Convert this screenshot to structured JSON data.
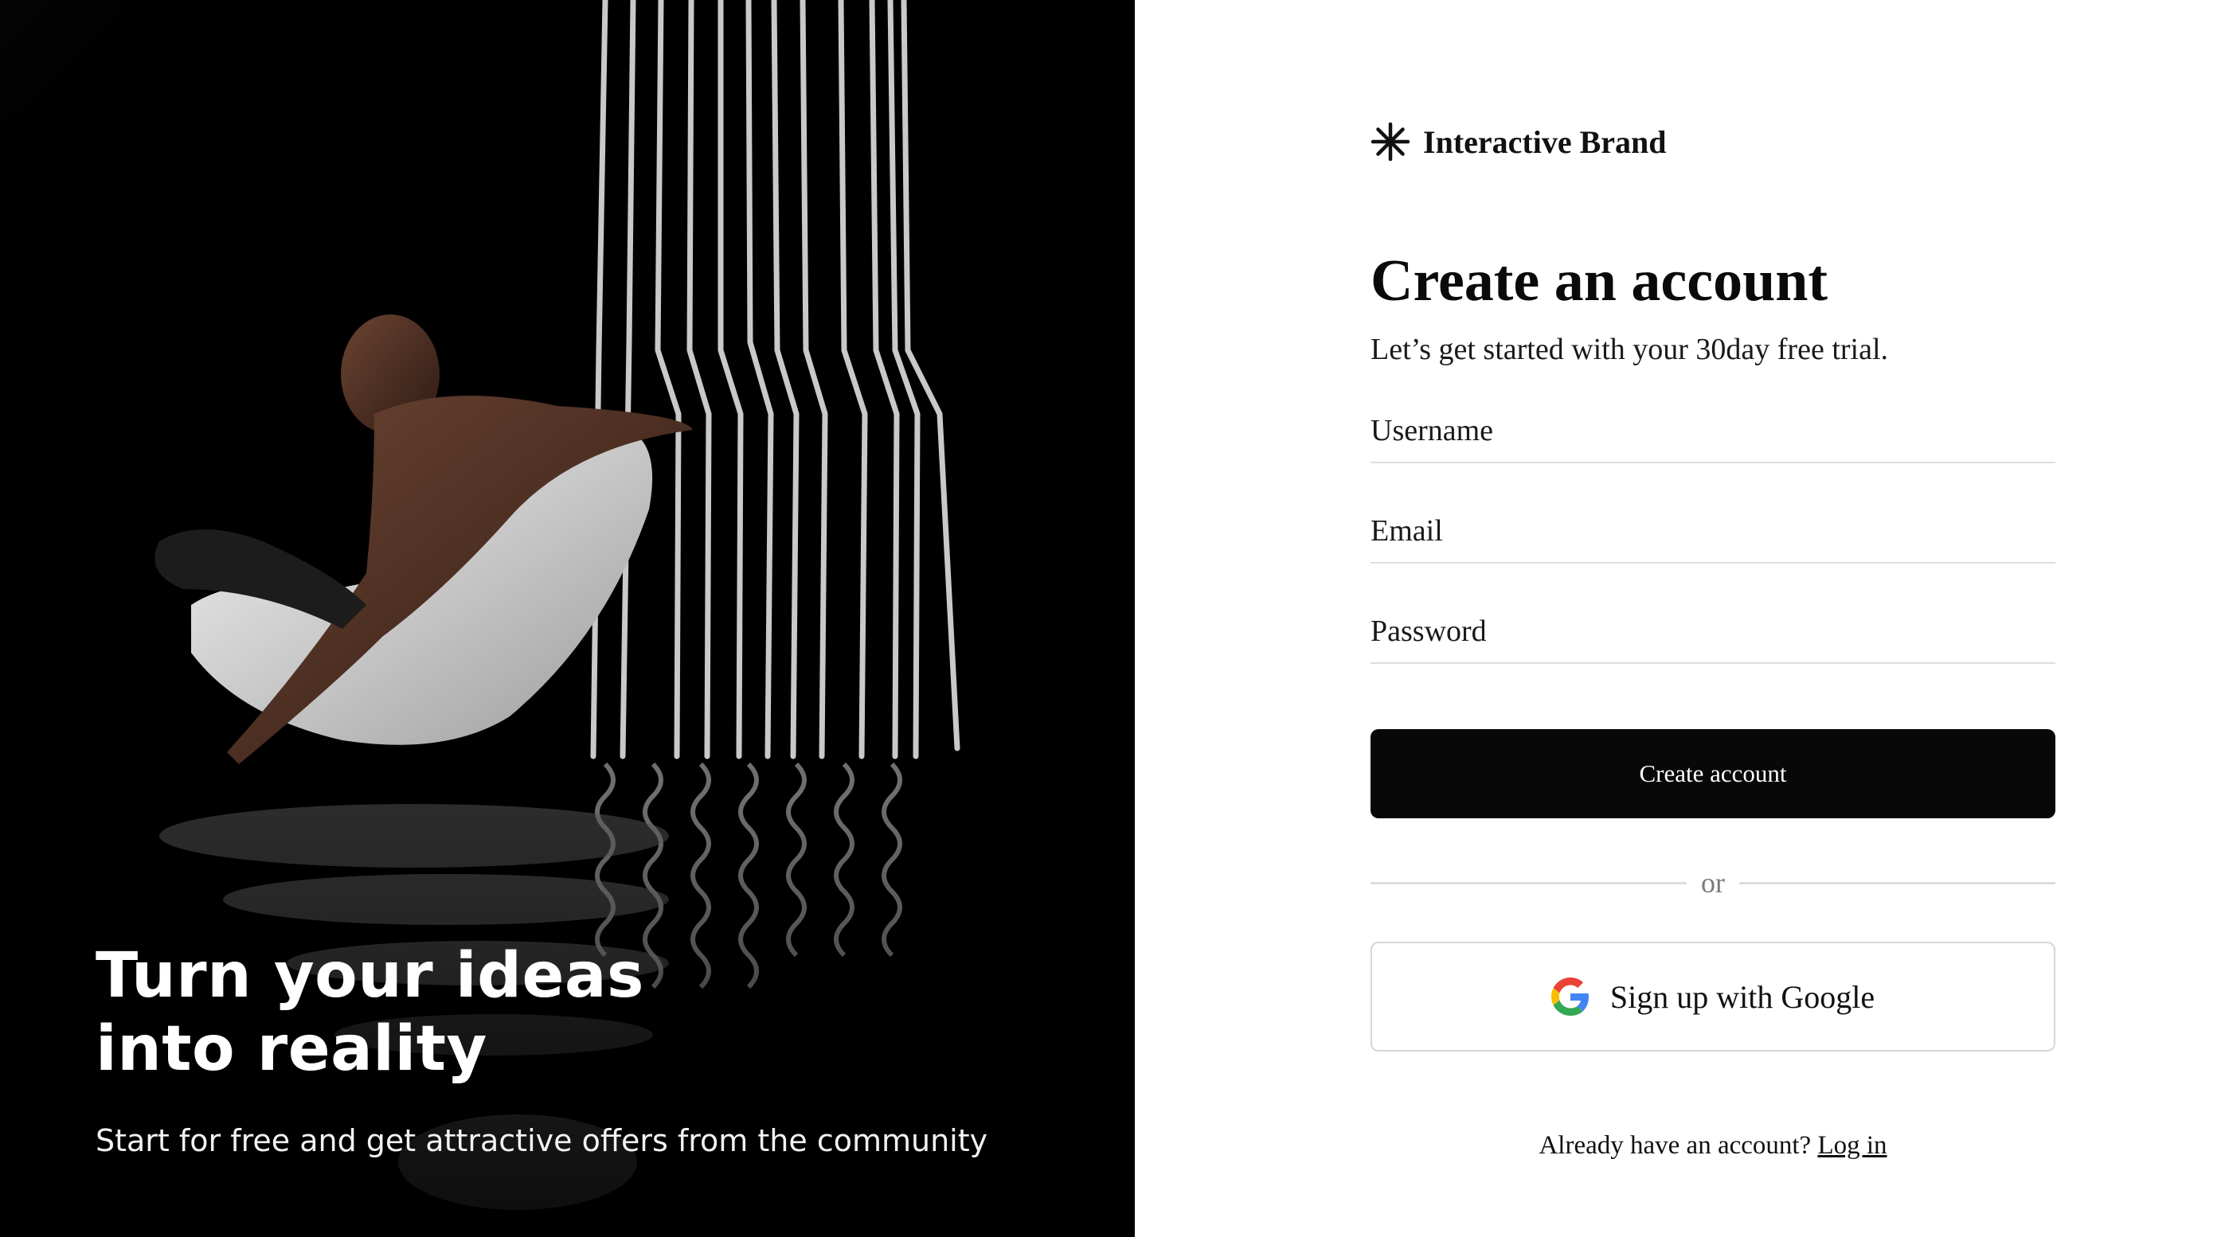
{
  "hero": {
    "title_line1": "Turn your ideas",
    "title_line2": "into reality",
    "subtitle": "Start for free and get attractive offers from the community"
  },
  "brand": {
    "name": "Interactive Brand",
    "icon": "asterisk-icon"
  },
  "form": {
    "title": "Create an account",
    "subtitle": "Let’s get started with your 30day free trial.",
    "username_placeholder": "Username",
    "email_placeholder": "Email",
    "password_placeholder": "Password",
    "submit_label": "Create account",
    "divider_text": "or",
    "google_label": "Sign up with Google",
    "google_icon": "google-icon",
    "login_prompt": "Already have an account?",
    "login_link": "Log in"
  },
  "colors": {
    "primary_button": "#080808",
    "background": "#ffffff",
    "hero_background": "#000000"
  }
}
